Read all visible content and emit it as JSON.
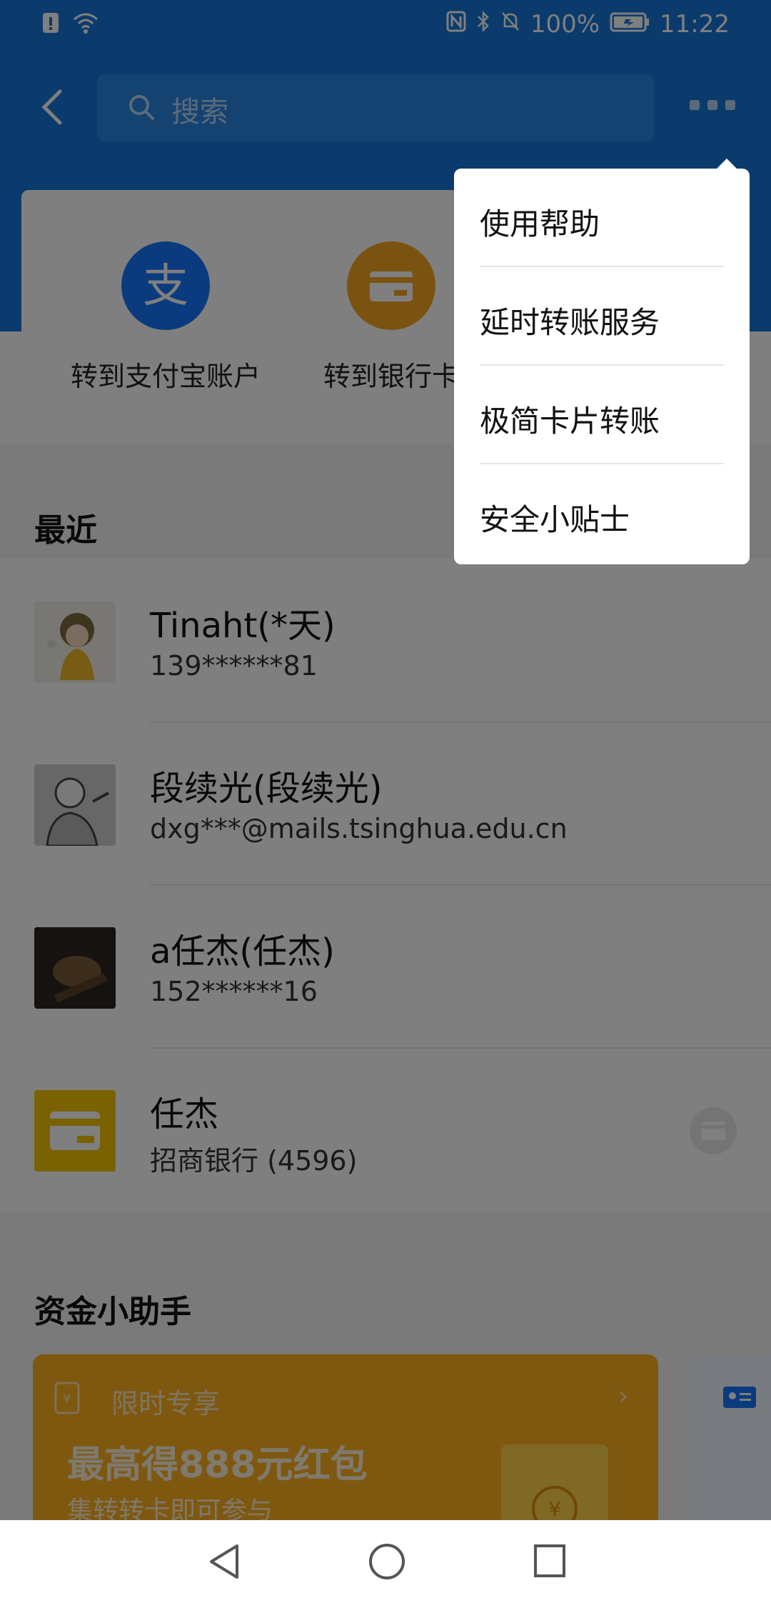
{
  "status_bar": {
    "battery": "100%",
    "time": "11:22"
  },
  "header": {
    "search_placeholder": "搜索"
  },
  "transfer_options": [
    {
      "label": "转到支付宝账户",
      "icon": "alipay-icon",
      "color": "#1677ff"
    },
    {
      "label": "转到银行卡",
      "icon": "bank-card-icon",
      "color": "#f5a623"
    }
  ],
  "recent": {
    "title": "最近",
    "contacts": [
      {
        "name": "Tinaht(*天)",
        "sub": "139******81"
      },
      {
        "name": "段续光(段续光)",
        "sub": "dxg***@mails.tsinghua.edu.cn"
      },
      {
        "name": "a任杰(任杰)",
        "sub": "152******16"
      },
      {
        "name": "任杰",
        "sub": "招商银行 (4596)"
      }
    ]
  },
  "helper": {
    "title": "资金小助手",
    "promo": {
      "tag": "限时专享",
      "headline": "最高得888元红包",
      "desc": "集转转卡即可参与"
    }
  },
  "menu": {
    "items": [
      {
        "label": "使用帮助"
      },
      {
        "label": "延时转账服务"
      },
      {
        "label": "极简卡片转账"
      },
      {
        "label": "安全小贴士"
      }
    ]
  },
  "colors": {
    "brand_blue": "#1677d8",
    "overlay": "rgba(0,0,0,0.5)"
  }
}
